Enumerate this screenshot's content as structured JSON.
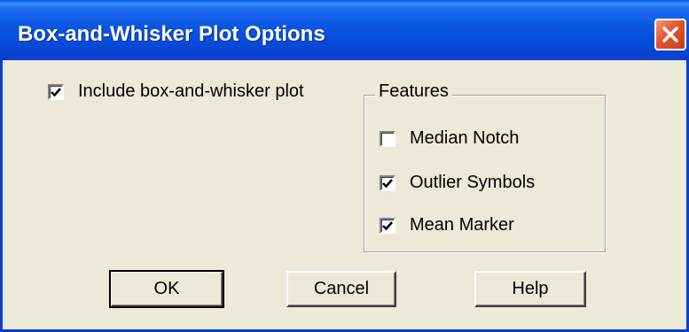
{
  "dialog": {
    "title": "Box-and-Whisker Plot Options"
  },
  "include_plot": {
    "label": "Include box-and-whisker plot",
    "checked": true
  },
  "features": {
    "title": "Features",
    "options": [
      {
        "label": "Median Notch",
        "checked": false
      },
      {
        "label": "Outlier Symbols",
        "checked": true
      },
      {
        "label": "Mean Marker",
        "checked": true
      }
    ]
  },
  "buttons": {
    "ok": "OK",
    "cancel": "Cancel",
    "help": "Help"
  },
  "icons": {
    "close": "close-icon",
    "check": "checkmark-icon"
  },
  "colors": {
    "titlebar": "#0A55E0",
    "close_button": "#E2552E",
    "dialog_background": "#ECE9D8"
  }
}
